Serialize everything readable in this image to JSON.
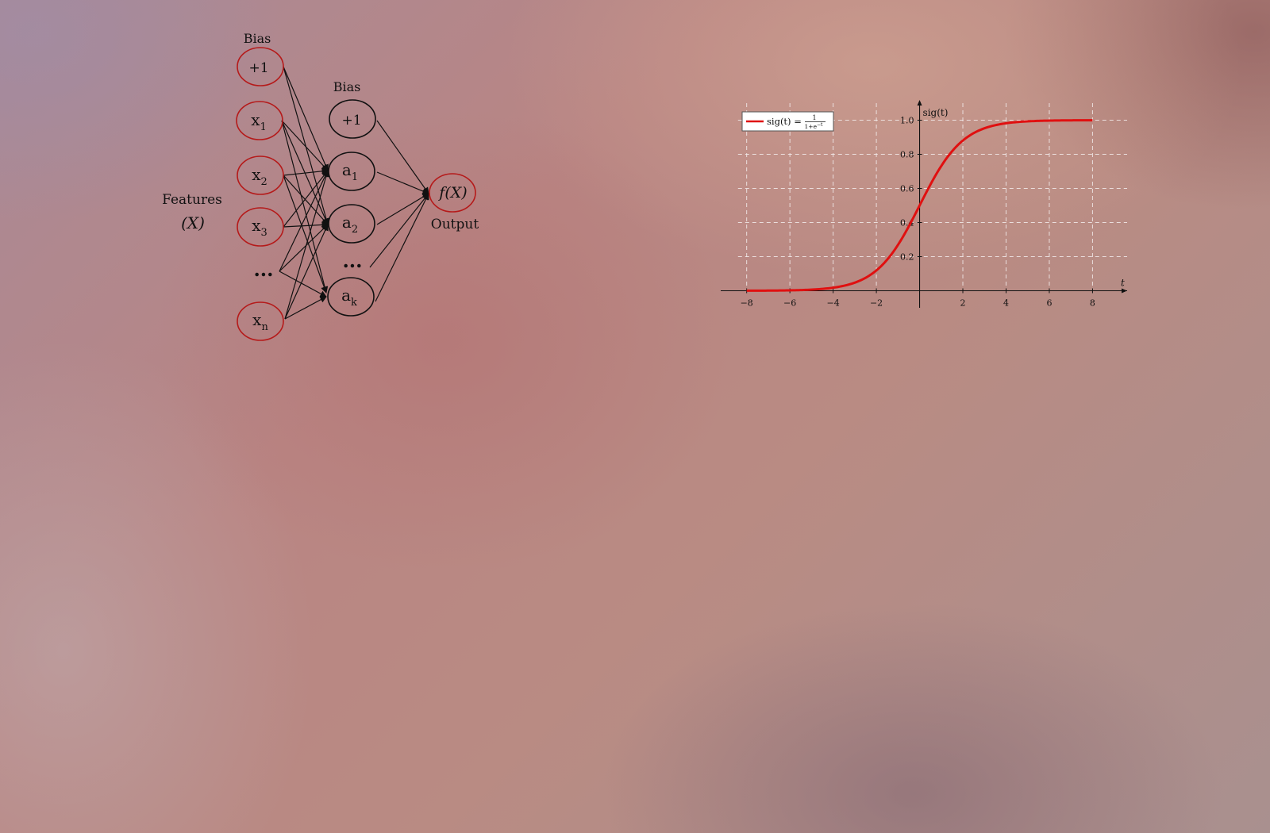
{
  "network": {
    "features_label": "Features",
    "features_symbol": "(X)",
    "input_bias_label": "Bias",
    "hidden_bias_label": "Bias",
    "output_label": "Output",
    "input_nodes": [
      {
        "base": "+1",
        "sub": ""
      },
      {
        "base": "x",
        "sub": "1"
      },
      {
        "base": "x",
        "sub": "2"
      },
      {
        "base": "x",
        "sub": "3"
      },
      {
        "base": "x",
        "sub": "n"
      }
    ],
    "input_ellipsis": "...",
    "hidden_nodes": [
      {
        "base": "+1",
        "sub": ""
      },
      {
        "base": "a",
        "sub": "1"
      },
      {
        "base": "a",
        "sub": "2"
      },
      {
        "base": "a",
        "sub": "k"
      }
    ],
    "hidden_ellipsis": "...",
    "output_node": "f(X)",
    "colors": {
      "input_border": "#b51a1a",
      "output_border": "#b51a1a",
      "hidden_border": "#111111"
    }
  },
  "chart_data": {
    "type": "line",
    "function": "sigmoid",
    "legend": {
      "text_main": "sig(t) = ",
      "frac_num": "1",
      "frac_den": "1+e",
      "frac_exp": "−t",
      "placement": "top-left"
    },
    "xlabel": "t",
    "ylabel": "sig(t)",
    "xlim": [
      -9.2,
      9.6
    ],
    "ylim": [
      -0.1,
      1.1
    ],
    "xticks": [
      -8,
      -6,
      -4,
      -2,
      2,
      4,
      6,
      8
    ],
    "xtick_labels": [
      "−8",
      "−6",
      "−4",
      "−2",
      "2",
      "4",
      "6",
      "8"
    ],
    "yticks": [
      0.2,
      0.4,
      0.6,
      0.8,
      1.0
    ],
    "ytick_labels": [
      "0.2",
      "0.4",
      "0.6",
      "0.8",
      "1.0"
    ],
    "grid": true,
    "series": [
      {
        "color": "#e01010",
        "x_range": [
          -8,
          8
        ]
      }
    ]
  }
}
